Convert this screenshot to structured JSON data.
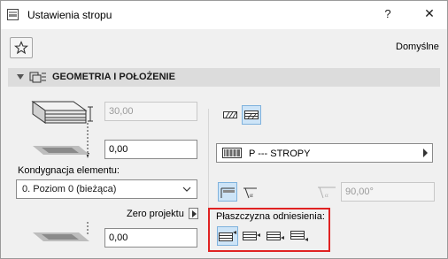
{
  "window": {
    "title": "Ustawienia stropu",
    "help_label": "?",
    "close_label": "✕"
  },
  "favorites": {
    "default_label": "Domyślne"
  },
  "section": {
    "title": "GEOMETRIA I POŁOŻENIE"
  },
  "geometry": {
    "thickness_value": "30,00",
    "top_offset_value": "0,00",
    "story_label": "Kondygnacja elementu:",
    "story_selected": "0. Poziom 0 (bieżąca)",
    "zero_label": "Zero projektu",
    "bottom_offset_value": "0,00"
  },
  "right_panel": {
    "layer_selected": "P --- STROPY",
    "angle_value": "90,00°",
    "reference_plane_label": "Płaszczyzna odniesienia:"
  },
  "colors": {
    "highlight_border": "#e02222",
    "active_toggle_bg": "#cde4f7"
  }
}
